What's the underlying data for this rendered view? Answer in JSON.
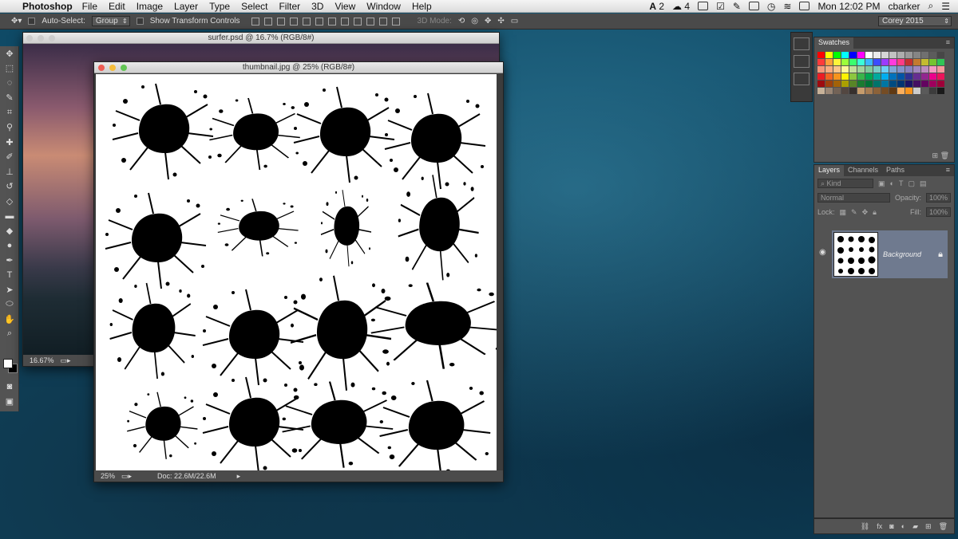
{
  "menubar": {
    "app_name": "Photoshop",
    "items": [
      "File",
      "Edit",
      "Image",
      "Layer",
      "Type",
      "Select",
      "Filter",
      "3D",
      "View",
      "Window",
      "Help"
    ],
    "status": {
      "adobe_count": "2",
      "cc_count": "4",
      "clock": "Mon 12:02 PM",
      "user": "cbarker"
    }
  },
  "optionsbar": {
    "auto_select_label": "Auto-Select:",
    "auto_select_value": "Group",
    "transform_label": "Show Transform Controls",
    "mode_label": "3D Mode:",
    "workspace": "Corey 2015"
  },
  "surfer_window": {
    "title": "surfer.psd @ 16.7% (RGB/8#)",
    "zoom": "16.67%"
  },
  "thumb_window": {
    "title": "thumbnail.jpg @ 25% (RGB/8#)",
    "zoom": "25%",
    "doc_info": "Doc: 22.6M/22.6M"
  },
  "swatches_panel": {
    "title": "Swatches",
    "colors": [
      "#ff0000",
      "#ffff00",
      "#00ff00",
      "#00ffff",
      "#0000ff",
      "#ff00ff",
      "#ffffff",
      "#ebebeb",
      "#d6d6d6",
      "#c2c2c2",
      "#adadad",
      "#999999",
      "#858585",
      "#707070",
      "#5c5c5c",
      "#474747",
      "#ff3b3b",
      "#ffa03b",
      "#fff43b",
      "#9cff3b",
      "#3bff6e",
      "#3bffd8",
      "#3bb8ff",
      "#3b4dff",
      "#9c3bff",
      "#ff3bde",
      "#ff3b86",
      "#c43030",
      "#c47a30",
      "#c4bb30",
      "#76c430",
      "#30c456",
      "#f7977a",
      "#f9ad81",
      "#fdc68a",
      "#fff79a",
      "#c4df9b",
      "#a2d39c",
      "#82ca9d",
      "#7bcdc8",
      "#6ecff6",
      "#7ea7d8",
      "#8493ca",
      "#8882be",
      "#a187be",
      "#bc8dbf",
      "#f49ac2",
      "#f6989d",
      "#ed1c24",
      "#f26522",
      "#f7941d",
      "#fff200",
      "#8dc73f",
      "#39b54a",
      "#00a651",
      "#00a99d",
      "#00aeef",
      "#0072bc",
      "#0054a6",
      "#2e3192",
      "#662d91",
      "#92278f",
      "#ec008c",
      "#ed145b",
      "#9e0b0f",
      "#a0410d",
      "#a36209",
      "#aba000",
      "#598527",
      "#197b30",
      "#007236",
      "#00746b",
      "#0076a3",
      "#004b80",
      "#003471",
      "#1b1464",
      "#440e62",
      "#630460",
      "#9e005d",
      "#9e0039",
      "#c7b299",
      "#998675",
      "#736357",
      "#534741",
      "#37302d",
      "#c69c6d",
      "#a67c52",
      "#8c6239",
      "#754c24",
      "#603913",
      "#fbaf5d",
      "#f7941d",
      "#cccccc",
      "#5a5a5a",
      "#3c3c3c",
      "#1a1a1a"
    ]
  },
  "layers_panel": {
    "tabs": [
      "Layers",
      "Channels",
      "Paths"
    ],
    "filter_kind": "Kind",
    "blend_mode": "Normal",
    "opacity_label": "Opacity:",
    "opacity_value": "100%",
    "lock_label": "Lock:",
    "fill_label": "Fill:",
    "fill_value": "100%",
    "layer_name": "Background"
  }
}
